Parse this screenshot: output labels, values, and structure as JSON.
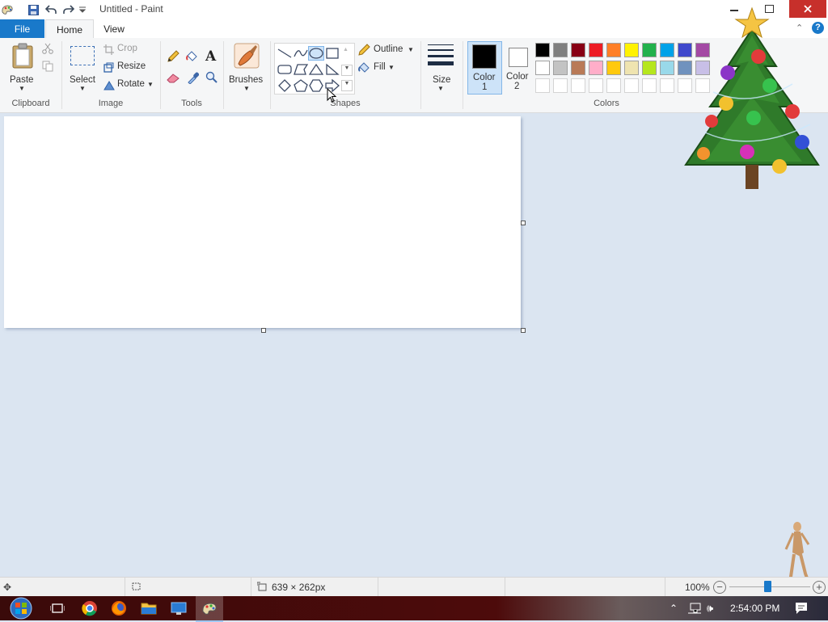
{
  "window": {
    "title": "Untitled - Paint",
    "minimize_icon": "minimize-icon",
    "maximize_icon": "restore-icon",
    "close_icon": "close-icon",
    "close_color": "#c7302b"
  },
  "tabs": [
    {
      "label": "File",
      "active_bg": "#1979ca"
    },
    {
      "label": "Home"
    },
    {
      "label": "View"
    }
  ],
  "ribbon": {
    "clipboard": {
      "paste": "Paste",
      "group": "Clipboard"
    },
    "image": {
      "select": "Select",
      "crop": "Crop",
      "resize": "Resize",
      "rotate": "Rotate",
      "group": "Image"
    },
    "tools": {
      "group": "Tools"
    },
    "brushes": {
      "label": "Brushes"
    },
    "shapes": {
      "outline": "Outline",
      "fill": "Fill",
      "group": "Shapes"
    },
    "size": {
      "label": "Size"
    },
    "color1": {
      "label": "Color",
      "num": "1",
      "value": "#000000"
    },
    "color2": {
      "label": "Color",
      "num": "2",
      "value": "#ffffff"
    },
    "colors": {
      "group": "Colors",
      "row1": [
        "#000000",
        "#7f7f7f",
        "#880015",
        "#ed1c24",
        "#ff7f27",
        "#fff200",
        "#22b14c",
        "#00a2e8",
        "#3f48cc",
        "#a349a4"
      ],
      "row2": [
        "#ffffff",
        "#c3c3c3",
        "#b97a57",
        "#ffaec9",
        "#ffc90e",
        "#efe4b0",
        "#b5e61d",
        "#99d9ea",
        "#7092be",
        "#c8bfe7"
      ]
    }
  },
  "statusbar": {
    "dimensions": "639 × 262px",
    "zoom": "100%",
    "zoom_level": 1.0
  },
  "taskbar": {
    "time": "2:54:00 PM"
  }
}
